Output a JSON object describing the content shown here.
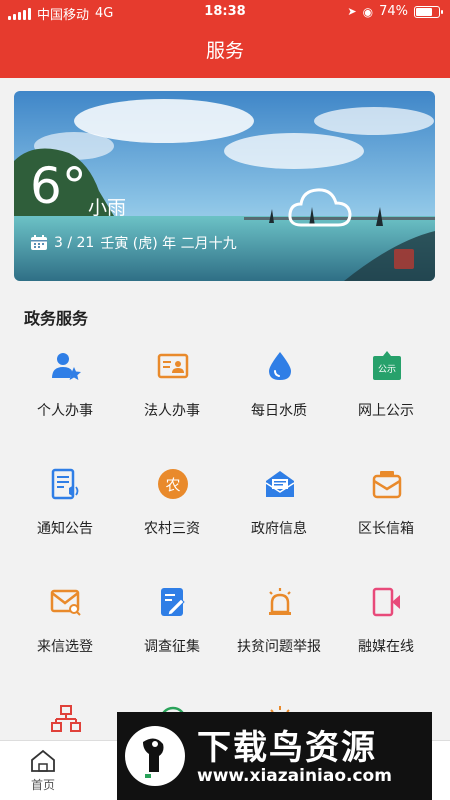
{
  "status_bar": {
    "carrier": "中国移动",
    "network": "4G",
    "time": "18:38",
    "battery": "74%",
    "battery_level": 0.74
  },
  "header": {
    "title": "服务"
  },
  "weather": {
    "temperature": "6°",
    "condition": "小雨",
    "date": "3 / 21",
    "lunar": "壬寅 (虎) 年 二月十九"
  },
  "section": {
    "title": "政务服务"
  },
  "services": [
    {
      "label": "个人办事",
      "icon": "person-icon",
      "color": "#2f7ee6"
    },
    {
      "label": "法人办事",
      "icon": "id-card-icon",
      "color": "#e98a2b"
    },
    {
      "label": "每日水质",
      "icon": "water-drop-icon",
      "color": "#2f7ee6"
    },
    {
      "label": "网上公示",
      "icon": "notice-board-icon",
      "color": "#27a16b",
      "badge": "公示"
    },
    {
      "label": "通知公告",
      "icon": "announcement-icon",
      "color": "#2f7ee6"
    },
    {
      "label": "农村三资",
      "icon": "rural-assets-icon",
      "color": "#e98a2b",
      "badge": "农"
    },
    {
      "label": "政府信息",
      "icon": "government-info-icon",
      "color": "#2f7ee6"
    },
    {
      "label": "区长信箱",
      "icon": "mailbox-icon",
      "color": "#e98a2b"
    },
    {
      "label": "来信选登",
      "icon": "letter-search-icon",
      "color": "#e98a2b"
    },
    {
      "label": "调查征集",
      "icon": "survey-icon",
      "color": "#2f7ee6"
    },
    {
      "label": "扶贫问题举报",
      "icon": "alarm-icon",
      "color": "#e98a2b"
    },
    {
      "label": "融媒在线",
      "icon": "media-online-icon",
      "color": "#e84a7a"
    }
  ],
  "bottom_nav": {
    "home_label": "首页"
  },
  "watermark": {
    "title": "下载鸟资源",
    "url": "www.xiazainiao.com"
  }
}
